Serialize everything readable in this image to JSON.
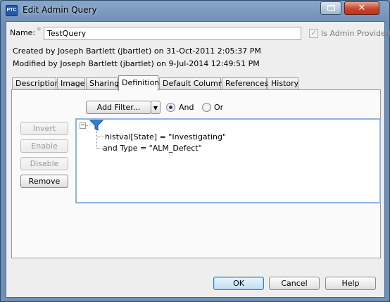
{
  "window": {
    "icon_text": "PTC",
    "title": "Edit Admin Query"
  },
  "form": {
    "name_label": "Name:",
    "name_value": "TestQuery",
    "admin_provided_label": "Is Admin Provided",
    "admin_provided_checked": true,
    "created_text": "Created by Joseph Bartlett (jbartlet) on 31-Oct-2011 2:05:37 PM",
    "modified_text": "Modified by Joseph Bartlett (jbartlet) on 9-Jul-2014 12:49:51 PM"
  },
  "tabs": [
    {
      "label": "Description",
      "active": false
    },
    {
      "label": "Image",
      "active": false
    },
    {
      "label": "Sharing",
      "active": false
    },
    {
      "label": "Definition",
      "active": true
    },
    {
      "label": "Default Columns",
      "active": false
    },
    {
      "label": "References",
      "active": false
    },
    {
      "label": "History",
      "active": false
    }
  ],
  "definition": {
    "add_filter_label": "Add Filter...",
    "radio_and_label": "And",
    "radio_or_label": "Or",
    "selected_operator": "And",
    "side_buttons": {
      "invert": "Invert",
      "enable": "Enable",
      "disable": "Disable",
      "remove": "Remove"
    },
    "conditions": [
      "histval[State] = \"Investigating\"",
      "and Type = \"ALM_Defect\""
    ]
  },
  "footer": {
    "ok": "OK",
    "cancel": "Cancel",
    "help": "Help"
  },
  "colors": {
    "title_bar": "#7395bc",
    "close_button": "#c9452b",
    "tree_border": "#8fb4e0",
    "funnel": "#2f7fd6"
  }
}
